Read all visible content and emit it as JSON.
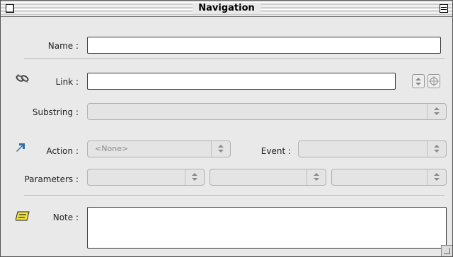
{
  "window": {
    "title": "Navigation"
  },
  "labels": {
    "name": "Name :",
    "link": "Link :",
    "substring": "Substring :",
    "action": "Action :",
    "event": "Event :",
    "parameters": "Parameters :",
    "note": "Note :"
  },
  "fields": {
    "name_value": "",
    "link_value": "",
    "note_value": ""
  },
  "popups": {
    "substring_value": "",
    "action_value": "<None>",
    "event_value": "",
    "parameter1_value": "",
    "parameter2_value": "",
    "parameter3_value": ""
  },
  "icons": {
    "link": "link-chain-icon",
    "action": "blue-arrow-icon",
    "note": "note-icon",
    "stepper": "up-down-arrows-icon",
    "target": "target-icon",
    "close": "close-box-icon",
    "collapse": "collapse-box-icon",
    "grow": "resize-grip-icon"
  },
  "colors": {
    "action_arrow": "#2d6fa8",
    "note_icon": "#f2e23a"
  }
}
